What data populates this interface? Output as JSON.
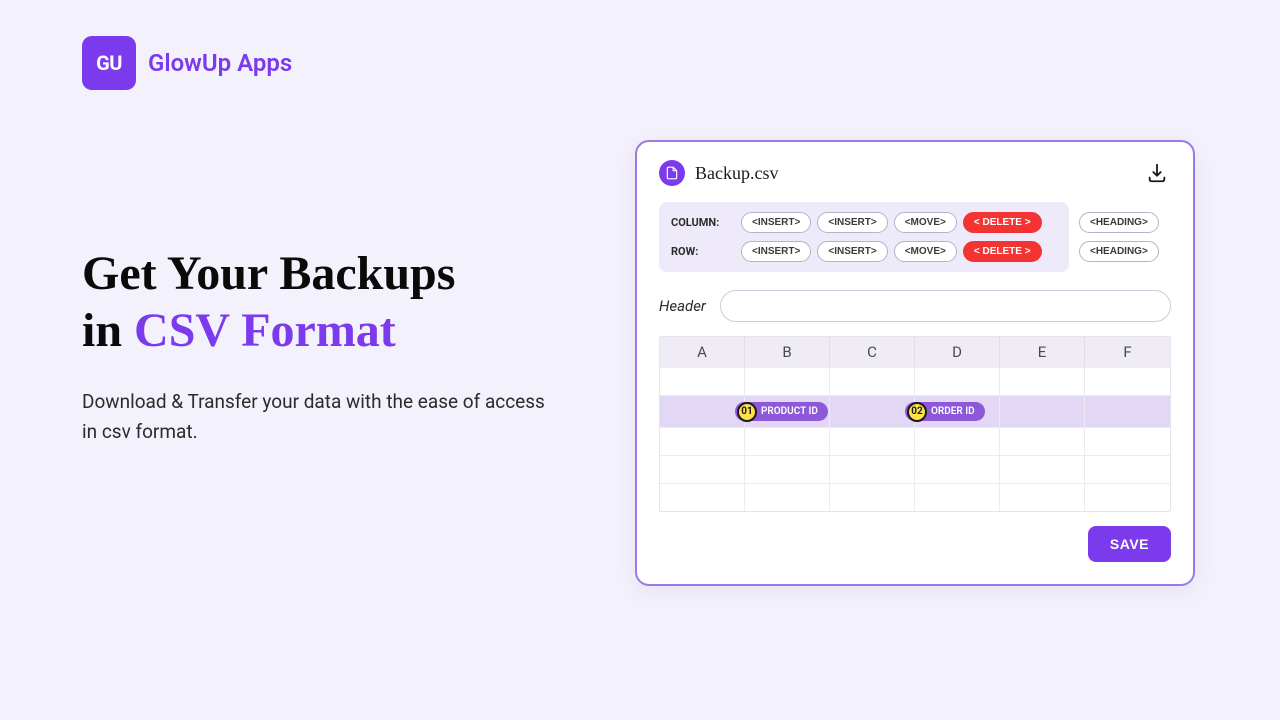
{
  "brand": {
    "name": "GlowUp Apps",
    "logo_text": "GU"
  },
  "hero": {
    "title_1": "Get Your Backups",
    "title_2_prefix": "in ",
    "title_2_accent": "CSV Format",
    "subtitle": "Download & Transfer your data with the ease of access in csv format."
  },
  "panel": {
    "file_name": "Backup.csv",
    "toolbar": {
      "column_label": "COLUMN:",
      "row_label": "ROW:",
      "buttons": {
        "insert1": "<INSERT>",
        "insert2": "<INSERT>",
        "move": "<MOVE>",
        "delete": "< DELETE >",
        "heading": "<HEADING>"
      }
    },
    "header_input": {
      "label": "Header",
      "value": ""
    },
    "grid": {
      "columns": [
        "A",
        "B",
        "C",
        "D",
        "E",
        "F"
      ],
      "chips": [
        {
          "num": "01",
          "label": "PRODUCT ID"
        },
        {
          "num": "02",
          "label": "ORDER ID"
        }
      ]
    },
    "save_label": "SAVE"
  }
}
